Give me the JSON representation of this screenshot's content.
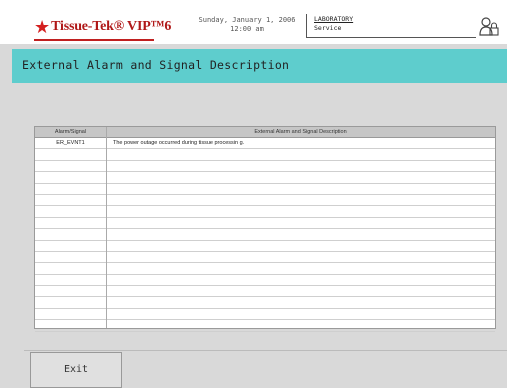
{
  "header": {
    "logo_text": "Tissue-Tek® VIP™6",
    "date_line": "Sunday, January 1, 2006",
    "time_line": "12:00 am",
    "lab_name": "LABORATORY",
    "role": "Service",
    "icon": "user-lock-icon"
  },
  "title": "External Alarm and Signal Description",
  "table": {
    "columns": [
      "Alarm/Signal",
      "External Alarm and Signal Description"
    ],
    "rows": [
      {
        "alarm": "ER_EVNT1",
        "desc": "The power outage occurred during tissue processin g."
      },
      {
        "alarm": "",
        "desc": ""
      },
      {
        "alarm": "",
        "desc": ""
      },
      {
        "alarm": "",
        "desc": ""
      },
      {
        "alarm": "",
        "desc": ""
      },
      {
        "alarm": "",
        "desc": ""
      },
      {
        "alarm": "",
        "desc": ""
      },
      {
        "alarm": "",
        "desc": ""
      },
      {
        "alarm": "",
        "desc": ""
      },
      {
        "alarm": "",
        "desc": ""
      },
      {
        "alarm": "",
        "desc": ""
      },
      {
        "alarm": "",
        "desc": ""
      },
      {
        "alarm": "",
        "desc": ""
      },
      {
        "alarm": "",
        "desc": ""
      },
      {
        "alarm": "",
        "desc": ""
      },
      {
        "alarm": "",
        "desc": ""
      },
      {
        "alarm": "",
        "desc": ""
      }
    ]
  },
  "footer": {
    "exit_label": "Exit"
  },
  "colors": {
    "title_bar": "#5ecdcd",
    "logo_red": "#b01818",
    "background": "#d9d9d9"
  }
}
